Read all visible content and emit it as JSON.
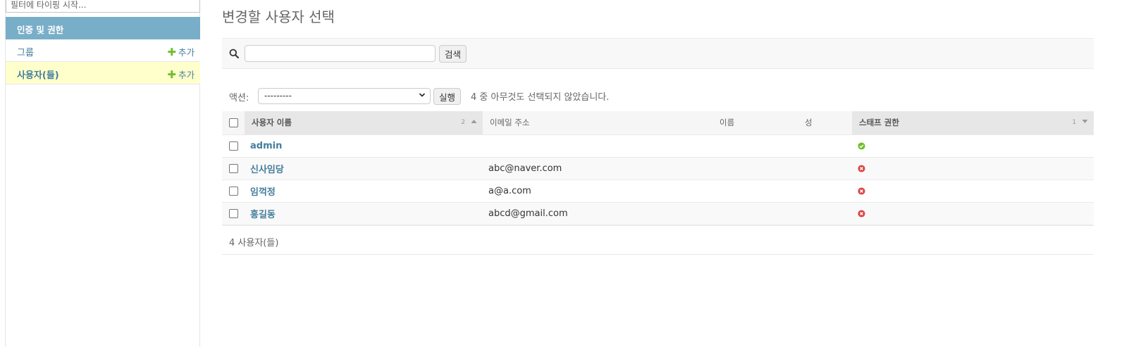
{
  "sidebar": {
    "filter_placeholder": "필터에 타이핑 시작...",
    "app_caption": "인증 및 권한",
    "models": [
      {
        "label": "그룹",
        "add_label": "추가"
      },
      {
        "label": "사용자(들)",
        "add_label": "추가"
      }
    ]
  },
  "main": {
    "title": "변경할 사용자 선택",
    "search": {
      "value": "",
      "button_label": "검색"
    },
    "actions": {
      "label": "액션:",
      "selected_option": "---------",
      "run_label": "실행",
      "counter": "4 중 아무것도 선택되지 않았습니다."
    },
    "table": {
      "columns": [
        {
          "label": "사용자 이름",
          "sort_priority": "2",
          "sort_dir": "asc"
        },
        {
          "label": "이메일 주소"
        },
        {
          "label": "이름"
        },
        {
          "label": "성"
        },
        {
          "label": "스태프 권한",
          "sort_priority": "1",
          "sort_dir": "desc"
        }
      ],
      "rows": [
        {
          "username": "admin",
          "email": "",
          "first_name": "",
          "last_name": "",
          "is_staff": true
        },
        {
          "username": "신사임당",
          "email": "abc@naver.com",
          "first_name": "",
          "last_name": "",
          "is_staff": false
        },
        {
          "username": "임꺽정",
          "email": "a@a.com",
          "first_name": "",
          "last_name": "",
          "is_staff": false
        },
        {
          "username": "홍길동",
          "email": "abcd@gmail.com",
          "first_name": "",
          "last_name": "",
          "is_staff": false
        }
      ]
    },
    "paginator": "4 사용자(들)"
  },
  "colors": {
    "caption_bg": "#79aec8",
    "link": "#447e9b",
    "highlight_row": "#ffffcc",
    "add_plus": "#70bf2b",
    "yes": "#70bf2b",
    "no": "#dd4646"
  },
  "icons": {
    "search": "search-icon",
    "add": "plus-icon",
    "yes": "check-circle-icon",
    "no": "x-circle-icon",
    "sort_asc": "sort-up-icon",
    "sort_desc": "sort-down-icon"
  }
}
